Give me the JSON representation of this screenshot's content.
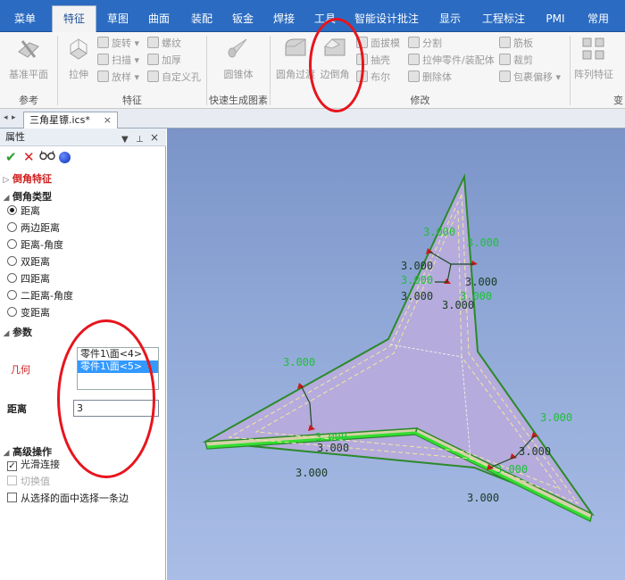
{
  "menu": {
    "tabs": [
      "菜单",
      "特征",
      "草图",
      "曲面",
      "装配",
      "钣金",
      "焊接",
      "工具",
      "智能设计批注",
      "显示",
      "工程标注",
      "PMI",
      "常用"
    ],
    "active": "特征"
  },
  "ribbon": {
    "groups": {
      "reference": {
        "label": "参考",
        "base_plane": "基准平面"
      },
      "feature": {
        "label": "特征",
        "extrude": "拉伸",
        "revolve": "旋转",
        "sweep": "扫描",
        "loft": "放样",
        "thread": "螺纹",
        "thicken": "加厚",
        "custom_hole": "自定义孔"
      },
      "quick": {
        "label": "快速生成图素",
        "cone": "圆锥体"
      },
      "modify": {
        "label": "修改",
        "fillet": "圆角过渡",
        "chamfer": "边倒角",
        "draft": "面拔模",
        "shell": "抽壳",
        "boolean": "布尔",
        "split": "分割",
        "extrude_part": "拉伸零件/装配体",
        "delete_body": "删除体",
        "rib": "筋板",
        "trim": "裁剪",
        "wrap_offset": "包裹偏移"
      },
      "array": {
        "label": "变",
        "pattern": "阵列特征"
      }
    }
  },
  "document": {
    "tab_title": "三角星镖.ics*",
    "close": "×"
  },
  "panel": {
    "title": "属性",
    "controls": {
      "dropdown": "▼",
      "pin": "⊥",
      "close": "×"
    },
    "actions": {
      "ok": "✔",
      "cancel": "✕",
      "preview": "&#x1F453;",
      "help": "●"
    },
    "feature_title": "倒角特征",
    "type_section": "倒角类型",
    "types": [
      "距离",
      "两边距离",
      "距离-角度",
      "双距离",
      "四距离",
      "二距离-角度",
      "变距离"
    ],
    "selected_type": 0,
    "param_section": "参数",
    "geometry_label": "几何",
    "faces": [
      "零件1\\面<4>",
      "零件1\\面<5>"
    ],
    "selected_face": 1,
    "distance_label": "距离",
    "distance_value": "3",
    "advanced_section": "高级操作",
    "options": [
      {
        "label": "光滑连接",
        "checked": true,
        "disabled": false
      },
      {
        "label": "切换值",
        "checked": false,
        "disabled": true
      },
      {
        "label": "从选择的面中选择一条边",
        "checked": false,
        "disabled": false
      }
    ]
  },
  "viewport": {
    "dimension_labels": [
      "3.000",
      "3.000",
      "3.000",
      "3.000",
      "3.000",
      "3.000",
      "3.000",
      "3.000",
      "3.000",
      "3.000",
      "3.000",
      "3.000",
      "3.000",
      "3.000",
      "3.000",
      "3.000"
    ],
    "colors": {
      "face": "#b5abdc",
      "edge": "#2a8a2a",
      "highlight": "#33dd33",
      "dims_green": "#1fbf3a",
      "dims_dark": "#1a3a24",
      "arrow": "#cc1a1a"
    }
  },
  "annotations": {
    "color": "#e8141c"
  }
}
